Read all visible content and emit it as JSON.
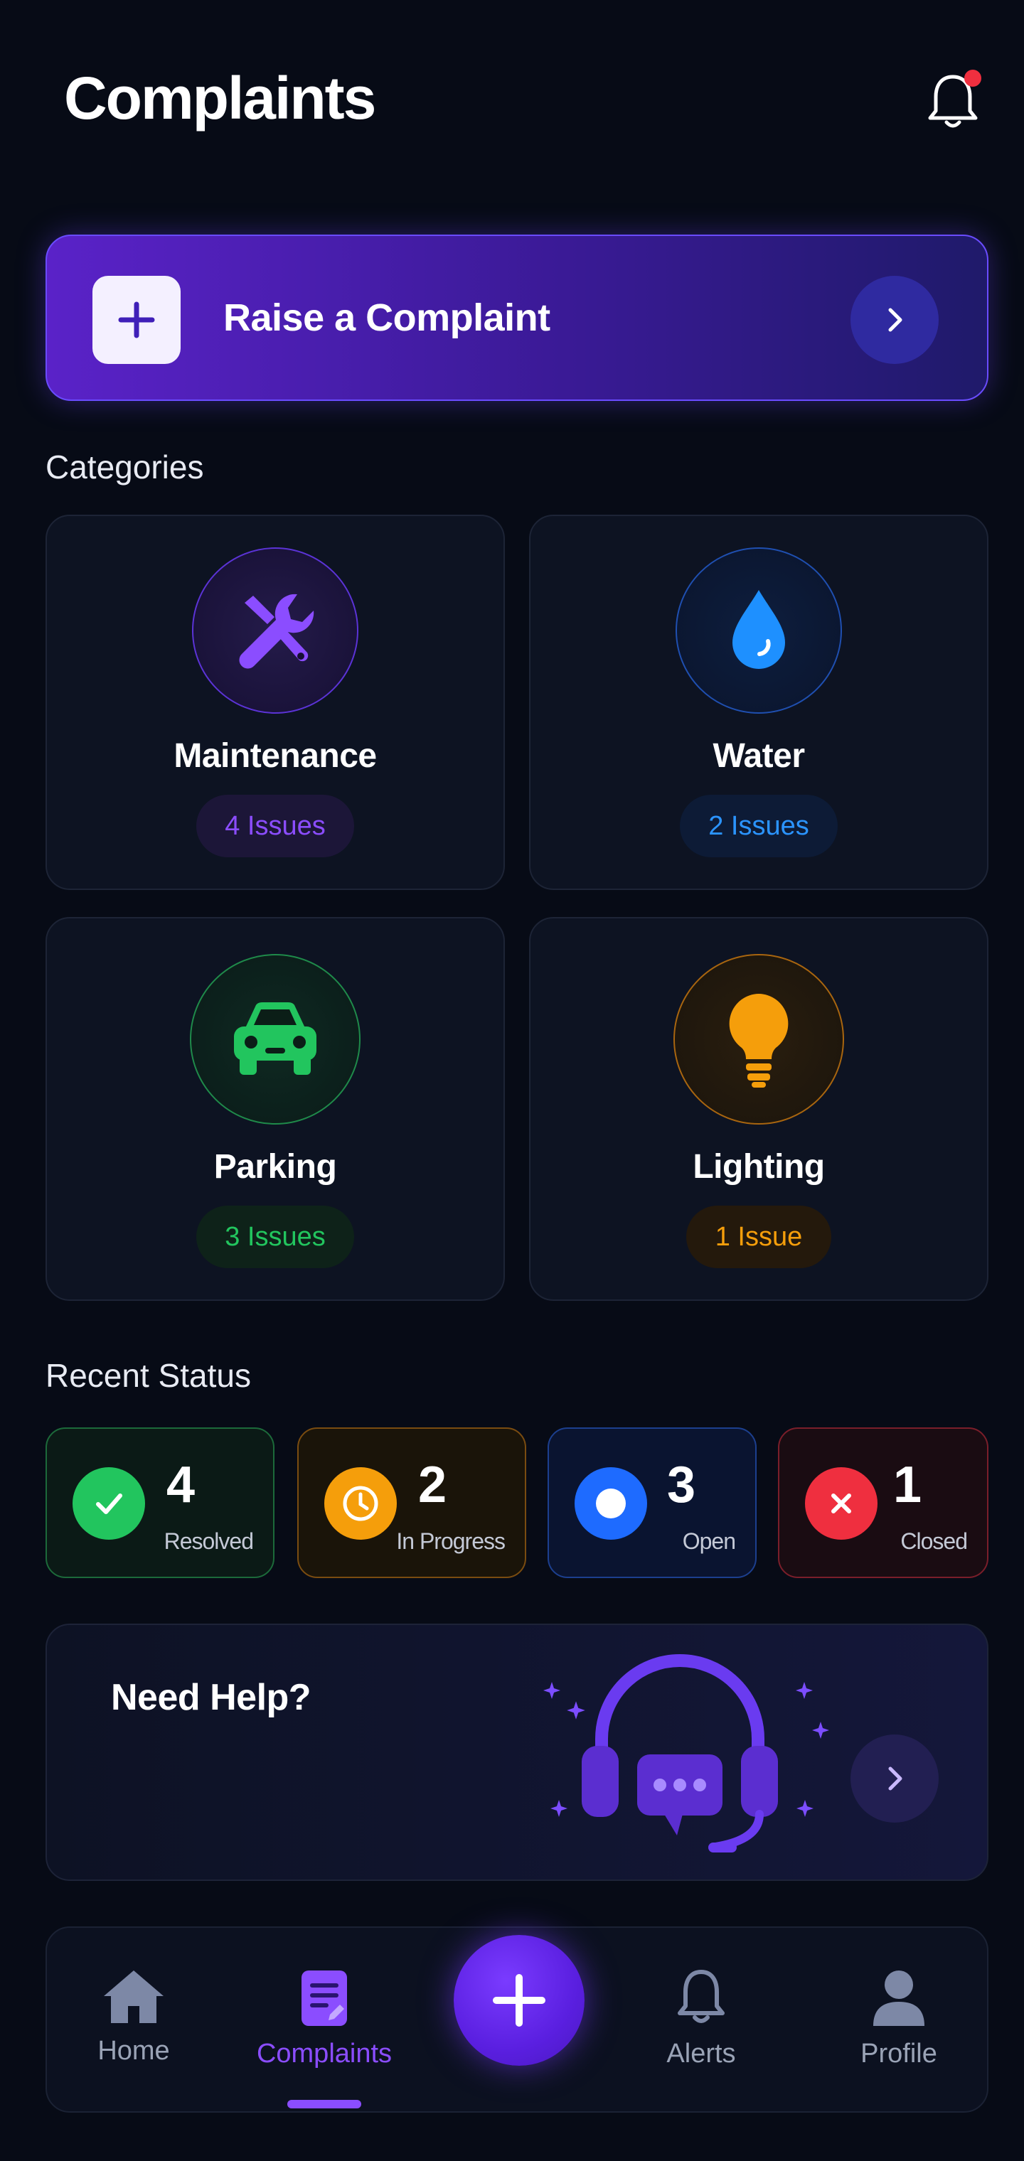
{
  "header": {
    "title": "Complaints"
  },
  "raise": {
    "label": "Raise a Complaint"
  },
  "categories": {
    "title": "Categories",
    "items": [
      {
        "name": "Maintenance",
        "badge": "4 Issues",
        "icon": "wrench-screwdriver-icon",
        "color": "#8b4dff"
      },
      {
        "name": "Water",
        "badge": "2 Issues",
        "icon": "water-drop-icon",
        "color": "#1e90ff"
      },
      {
        "name": "Parking",
        "badge": "3 Issues",
        "icon": "car-icon",
        "color": "#22c55e"
      },
      {
        "name": "Lighting",
        "badge": "1 Issue",
        "icon": "light-bulb-icon",
        "color": "#f59e0b"
      }
    ]
  },
  "status": {
    "title": "Recent Status",
    "items": [
      {
        "count": "4",
        "label": "Resolved",
        "icon": "check-icon",
        "color": "#22c55e"
      },
      {
        "count": "2",
        "label": "In Progress",
        "icon": "clock-icon",
        "color": "#f59e0b"
      },
      {
        "count": "3",
        "label": "Open",
        "icon": "dot-icon",
        "color": "#1e6bff"
      },
      {
        "count": "1",
        "label": "Closed",
        "icon": "x-icon",
        "color": "#ef2f3f"
      }
    ]
  },
  "help": {
    "title": "Need Help?",
    "icon": "headset-chat-icon"
  },
  "nav": {
    "items": [
      {
        "label": "Home",
        "icon": "home-icon"
      },
      {
        "label": "Complaints",
        "icon": "document-icon",
        "active": true
      },
      {
        "label": "Alerts",
        "icon": "bell-icon"
      },
      {
        "label": "Profile",
        "icon": "user-icon"
      }
    ],
    "fab_icon": "plus-icon"
  },
  "colors": {
    "accent": "#8b4dff",
    "background": "#070b16",
    "notification": "#ef2f3f"
  }
}
